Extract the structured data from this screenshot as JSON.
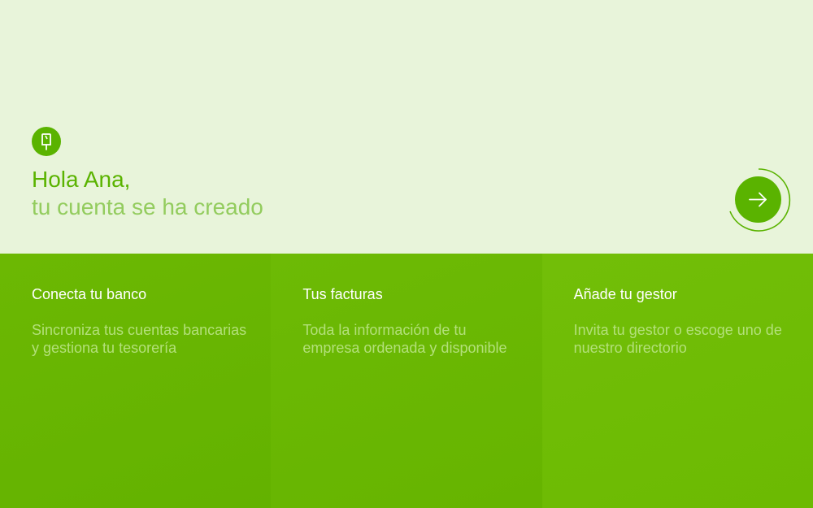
{
  "header": {
    "logo_icon": "popsicle-icon",
    "greeting": "Hola Ana,",
    "subtitle": "tu cuenta se ha creado",
    "next_icon": "arrow-right-icon"
  },
  "panels": [
    {
      "title": "Conecta tu banco",
      "description": "Sincroniza tus cuentas bancarias y gestiona tu tesorería"
    },
    {
      "title": "Tus facturas",
      "description": "Toda la información de tu empresa ordenada y disponible"
    },
    {
      "title": "Añade tu gestor",
      "description": "Invita tu gestor o escoge uno de nuestro directorio"
    }
  ],
  "colors": {
    "accent": "#5ab300",
    "background": "#e8f4da",
    "subtitle": "#93cc5e",
    "panel_text_muted": "#b3e07a"
  }
}
